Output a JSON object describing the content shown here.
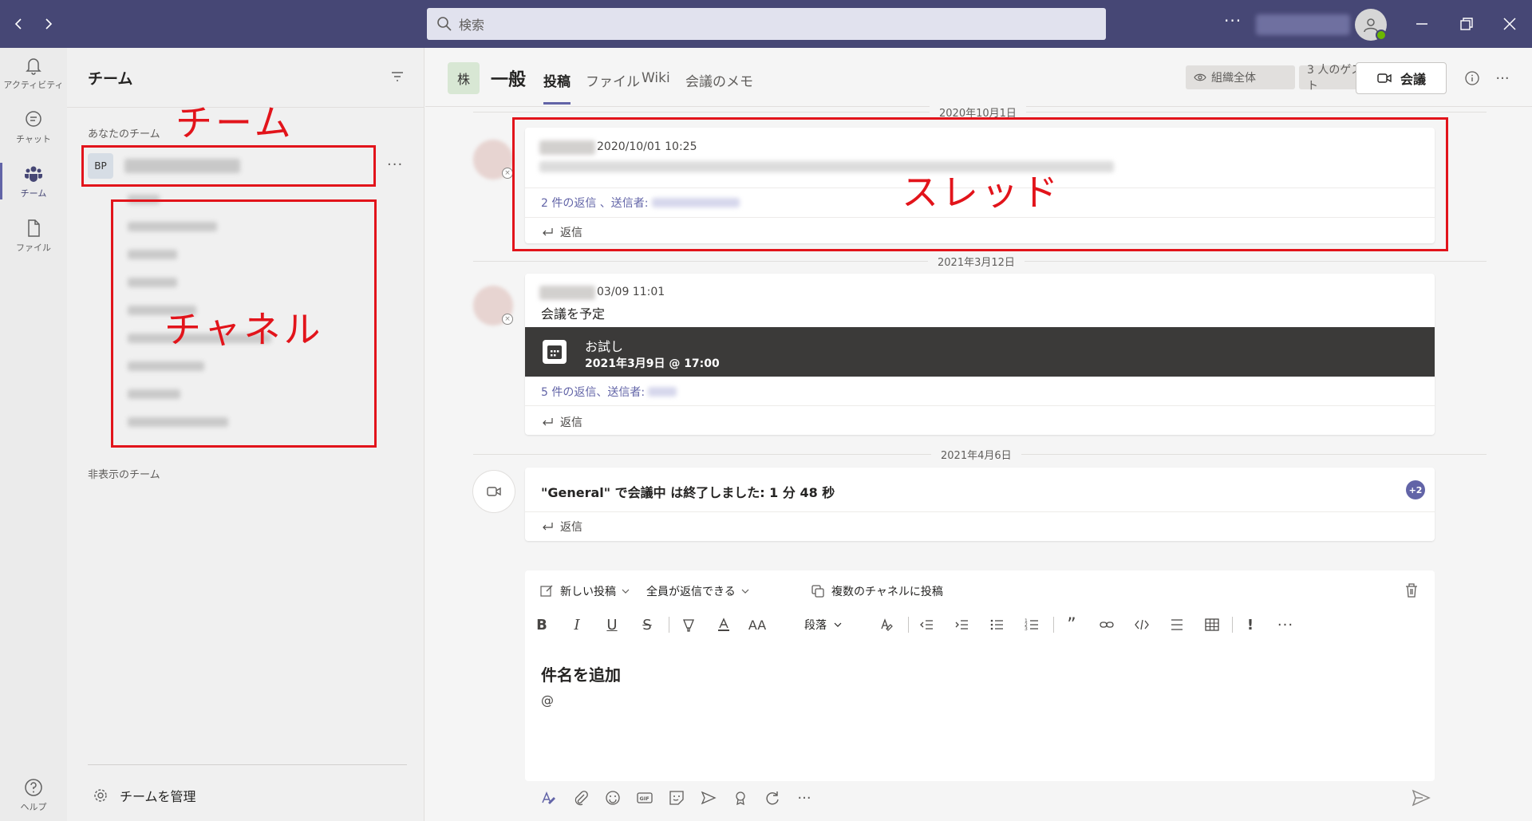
{
  "titlebar": {
    "search_placeholder": "検索",
    "more": "···"
  },
  "appbar": {
    "items": [
      {
        "label": "アクティビティ",
        "icon": "bell-icon"
      },
      {
        "label": "チャット",
        "icon": "chat-icon"
      },
      {
        "label": "チーム",
        "icon": "teams-icon"
      },
      {
        "label": "ファイル",
        "icon": "file-icon"
      }
    ],
    "help": {
      "label": "ヘルプ",
      "icon": "help-icon"
    }
  },
  "teams_pane": {
    "title": "チーム",
    "your_teams_label": "あなたのチーム",
    "team": {
      "initials": "BP"
    },
    "team_more": "···",
    "hidden_teams_label": "非表示のチーム",
    "manage_label": "チームを管理"
  },
  "channel": {
    "icon_text": "株",
    "name": "一般",
    "tabs": [
      "投稿",
      "ファイル",
      "Wiki",
      "会議のメモ"
    ],
    "org_wide": "組織全体",
    "guests": "3 人のゲスト",
    "meet_label": "会議",
    "more": "···"
  },
  "feed": {
    "date1": "2020年10月1日",
    "msg1": {
      "time": "2020/10/01 10:25",
      "replies": "2 件の返信 、送信者:",
      "reply": "返信"
    },
    "date2": "2021年3月12日",
    "msg2": {
      "time": "03/09 11:01",
      "body": "会議を予定",
      "event_title": "お試し",
      "event_date": "2021年3月9日 @ 17:00",
      "replies": "5 件の返信、送信者:",
      "reply": "返信"
    },
    "date3": "2021年4月6日",
    "msg3": {
      "text": "\"General\" で会議中 は終了しました: 1 分 48 秒",
      "badge": "+2",
      "reply": "返信"
    }
  },
  "compose": {
    "new_post": "新しい投稿",
    "everyone_reply": "全員が返信できる",
    "multi_channel": "複数のチャネルに投稿",
    "paragraph": "段落",
    "subject_placeholder": "件名を追加",
    "at": "@",
    "gif": "GIF",
    "more": "···"
  },
  "annotations": {
    "team": "チーム",
    "channel": "チャネル",
    "thread": "スレッド"
  }
}
